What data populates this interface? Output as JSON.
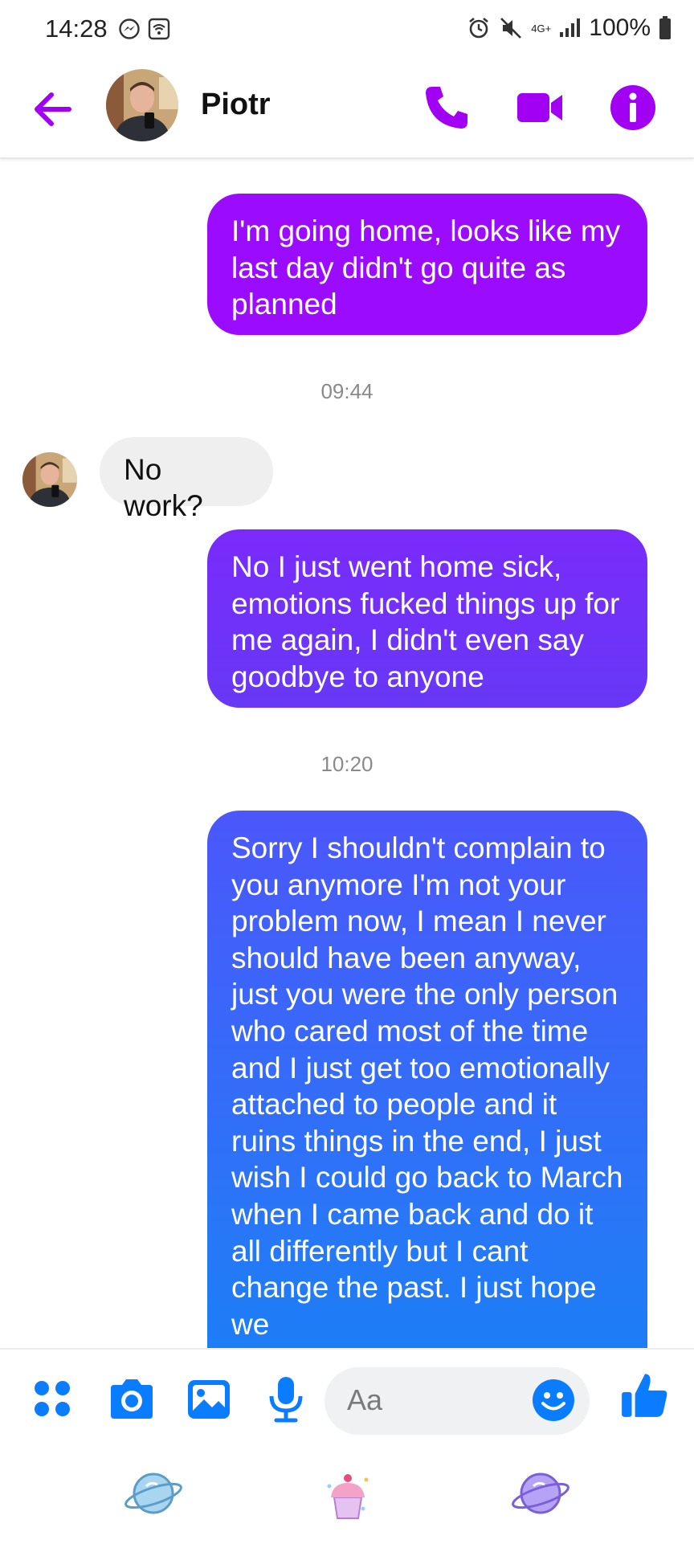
{
  "status_bar": {
    "time": "14:28",
    "battery": "100%",
    "network": "4G+"
  },
  "header": {
    "contact_name": "Piotr",
    "icons": [
      "back-arrow-icon",
      "phone-icon",
      "video-camera-icon",
      "info-icon"
    ],
    "accent_color": "#a100f2"
  },
  "messages": [
    {
      "direction": "outgoing",
      "text": "I'm going home, looks like my last day didn't go quite as planned",
      "color": "#9b0cff"
    },
    {
      "type": "timestamp",
      "text": "09:44"
    },
    {
      "direction": "incoming",
      "text": "No work?"
    },
    {
      "direction": "outgoing",
      "text": "No I just went home sick, emotions fucked things up for me again, I didn't even say goodbye to anyone",
      "color": "#6b34f7"
    },
    {
      "type": "timestamp",
      "text": "10:20"
    },
    {
      "direction": "outgoing",
      "text": "Sorry I shouldn't complain to you anymore I'm not your problem now, I mean I never should have been anyway, just you were the only person who cared most of the time and I just get too emotionally attached to people and it ruins things in the end, I just wish I could go back to March when I came back and do it all differently but I cant change the past. I just hope we",
      "color": "#2f6bf6"
    }
  ],
  "composer": {
    "placeholder": "Aa",
    "icons": [
      "apps-icon",
      "camera-icon",
      "gallery-icon",
      "microphone-icon",
      "emoji-icon",
      "thumbs-up-icon"
    ],
    "accent_color": "#0a7cff"
  },
  "stickers": [
    "planet-sticker",
    "cupcake-sticker",
    "purple-planet-sticker"
  ]
}
